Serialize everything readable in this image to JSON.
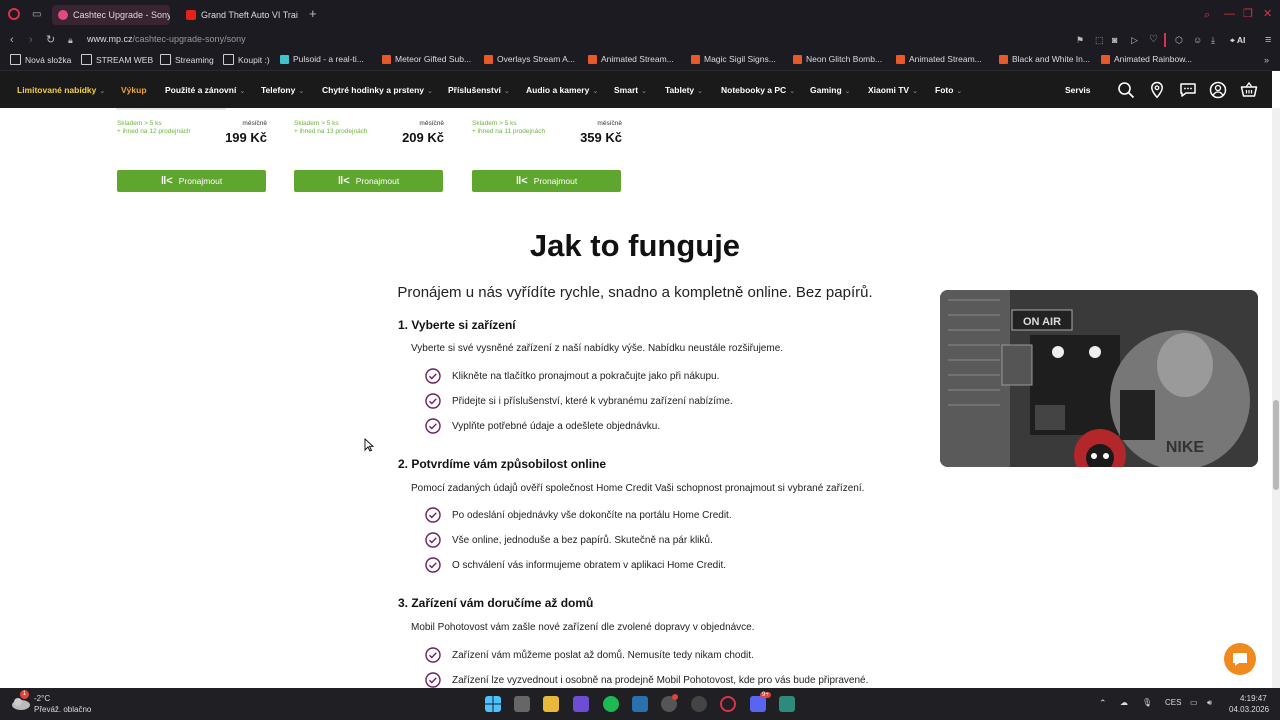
{
  "browser": {
    "tabs": [
      {
        "title": "Cashtec Upgrade - Sony",
        "active": true
      },
      {
        "title": "Grand Theft Auto VI Trailer",
        "active": false
      }
    ],
    "new_tab": "+",
    "url_domain": "www.mp.cz",
    "url_path": "/cashtec-upgrade-sony/sony",
    "ai_label": "AI",
    "bookmarks": [
      {
        "label": "Nová složka",
        "icon": "folder-icon"
      },
      {
        "label": "STREAM WEB",
        "icon": "folder-icon"
      },
      {
        "label": "Streaming",
        "icon": "folder-icon"
      },
      {
        "label": "Koupit :)",
        "icon": "folder-icon"
      },
      {
        "label": "Pulsoid - a real-ti...",
        "icon": "pulsoid-icon"
      },
      {
        "label": "Meteor Gifted Sub...",
        "icon": "etsy-icon"
      },
      {
        "label": "Overlays Stream A...",
        "icon": "etsy-icon"
      },
      {
        "label": "Animated Stream...",
        "icon": "etsy-icon"
      },
      {
        "label": "Magic Sigil Signs...",
        "icon": "etsy-icon"
      },
      {
        "label": "Neon Glitch Bomb...",
        "icon": "etsy-icon"
      },
      {
        "label": "Animated Stream...",
        "icon": "etsy-icon"
      },
      {
        "label": "Black and White In...",
        "icon": "etsy-icon"
      },
      {
        "label": "Animated Rainbow...",
        "icon": "etsy-icon"
      }
    ],
    "colors": {
      "accent": "#d8334a",
      "etsy": "#e8592a"
    }
  },
  "site_nav": {
    "items": [
      {
        "label": "Limitované nabídky",
        "chevron": true,
        "color": "#f4d03f"
      },
      {
        "label": "Výkup",
        "chevron": false,
        "color": "#f0a23c"
      },
      {
        "label": "Použité a zánovní",
        "chevron": true,
        "color": "#ffffff"
      },
      {
        "label": "Telefony",
        "chevron": true,
        "color": "#ffffff"
      },
      {
        "label": "Chytré hodinky a prsteny",
        "chevron": true,
        "color": "#ffffff"
      },
      {
        "label": "Příslušenství",
        "chevron": true,
        "color": "#ffffff"
      },
      {
        "label": "Audio a kamery",
        "chevron": true,
        "color": "#ffffff"
      },
      {
        "label": "Smart",
        "chevron": true,
        "color": "#ffffff"
      },
      {
        "label": "Tablety",
        "chevron": true,
        "color": "#ffffff"
      },
      {
        "label": "Notebooky a PC",
        "chevron": true,
        "color": "#ffffff"
      },
      {
        "label": "Gaming",
        "chevron": true,
        "color": "#ffffff"
      },
      {
        "label": "Xiaomi TV",
        "chevron": true,
        "color": "#ffffff"
      },
      {
        "label": "Foto",
        "chevron": true,
        "color": "#ffffff"
      }
    ],
    "chevron_glyph": "⌄",
    "servis": "Servis",
    "icons": [
      "search-icon",
      "location-pin-icon",
      "chat-icon",
      "user-icon",
      "cart-icon"
    ]
  },
  "products": [
    {
      "stock": "Skladem > 5 ks",
      "pickup": "+ ihned na 12 prodejnách",
      "period": "měsíčně",
      "price": "199 Kč",
      "button": "Pronajmout"
    },
    {
      "stock": "Skladem > 5 ks",
      "pickup": "+ ihned na 13 prodejnách",
      "period": "měsíčně",
      "price": "209 Kč",
      "button": "Pronajmout"
    },
    {
      "stock": "Skladem > 5 ks",
      "pickup": "+ ihned na 11 prodejnách",
      "period": "měsíčně",
      "price": "359 Kč",
      "button": "Pronajmout"
    }
  ],
  "how": {
    "title": "Jak to funguje",
    "subtitle": "Pronájem u nás vyřídíte rychle, snadno a kompletně online. Bez papírů.",
    "steps": [
      {
        "heading": "1. Vyberte si zařízení",
        "desc": "Vyberte si své vysněné zařízení z naší nabídky výše. Nabídku neustále rozšiřujeme.",
        "items": [
          "Klikněte na tlačítko pronajmout a pokračujte jako při nákupu.",
          "Přidejte si i příslušenství, které k vybranému zařízení nabízíme.",
          "Vyplňte potřebné údaje a odešlete objednávku."
        ]
      },
      {
        "heading": "2. Potvrdíme vám způsobilost online",
        "desc": "Pomocí zadaných údajů ověří společnost Home Credit Vaši schopnost pronajmout si vybrané zařízení.",
        "items": [
          "Po odeslání objednávky vše dokončíte na portálu Home Credit.",
          "Vše online, jednoduše a bez papírů. Skutečně na pár kliků.",
          "O schválení vás informujeme obratem v aplikaci Home Credit."
        ]
      },
      {
        "heading": "3. Zařízení vám doručíme až domů",
        "desc": "Mobil Pohotovost vám zašle nové zařízení dle zvolené dopravy v objednávce.",
        "items": [
          " Zařízení vám můžeme poslat až domů. Nemusíte tedy nikam chodit.",
          "Zařízení lze vyzvednout i osobně na prodejně Mobil Pohotovost, kde pro vás bude připravené."
        ]
      }
    ],
    "colors": {
      "check": "#6b1f63",
      "button": "#5fa62f",
      "stock": "#6cb33f"
    }
  },
  "webcam": {
    "sign": "ON AIR",
    "brand": "NIKE"
  },
  "taskbar": {
    "weather_temp": "-2°C",
    "weather_desc": "Převáž. oblačno",
    "weather_badge": "1",
    "lang": "CES",
    "time": "4:19:47",
    "date": "04.03.2026",
    "app_badge": "9+"
  }
}
